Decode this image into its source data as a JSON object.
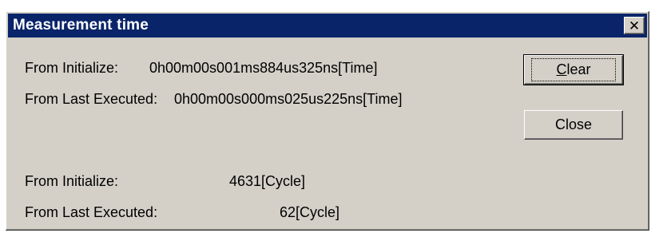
{
  "window": {
    "title": "Measurement time",
    "close_glyph": "✕"
  },
  "time": {
    "from_initialize_label": "From Initialize:",
    "from_initialize_value": "0h00m00s001ms884us325ns[Time]",
    "from_last_executed_label": "From Last Executed:",
    "from_last_executed_value": "0h00m00s000ms025us225ns[Time]"
  },
  "cycle": {
    "from_initialize_label": "From Initialize:",
    "from_initialize_value": "4631[Cycle]",
    "from_last_executed_label": "From Last Executed:",
    "from_last_executed_value": "62[Cycle]"
  },
  "buttons": {
    "clear_mnemonic": "C",
    "clear_rest": "lear",
    "close_label": "Close"
  }
}
